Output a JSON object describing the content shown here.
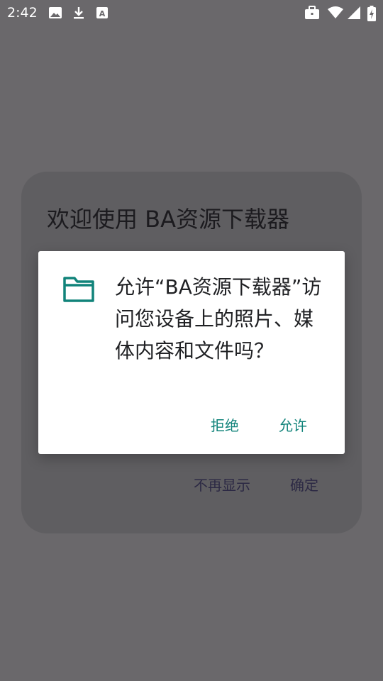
{
  "status_bar": {
    "time": "2:42",
    "left_icons": [
      "image-icon",
      "download-icon",
      "font-icon"
    ],
    "right_icons": [
      "briefcase-icon",
      "wifi-icon",
      "signal-icon",
      "battery-charging-icon"
    ]
  },
  "background_dialog": {
    "title": "欢迎使用 BA资源下载器",
    "hide_button": "不再显示",
    "ok_button": "确定"
  },
  "permission_dialog": {
    "icon": "folder-icon",
    "message": "允许“BA资源下载器”访问您设备上的照片、媒体内容和文件吗？",
    "deny_button": "拒绝",
    "allow_button": "允许",
    "accent_color": "#11837a"
  },
  "colors": {
    "scrim": "#6a686b",
    "dialog_background": "#ffffff"
  }
}
